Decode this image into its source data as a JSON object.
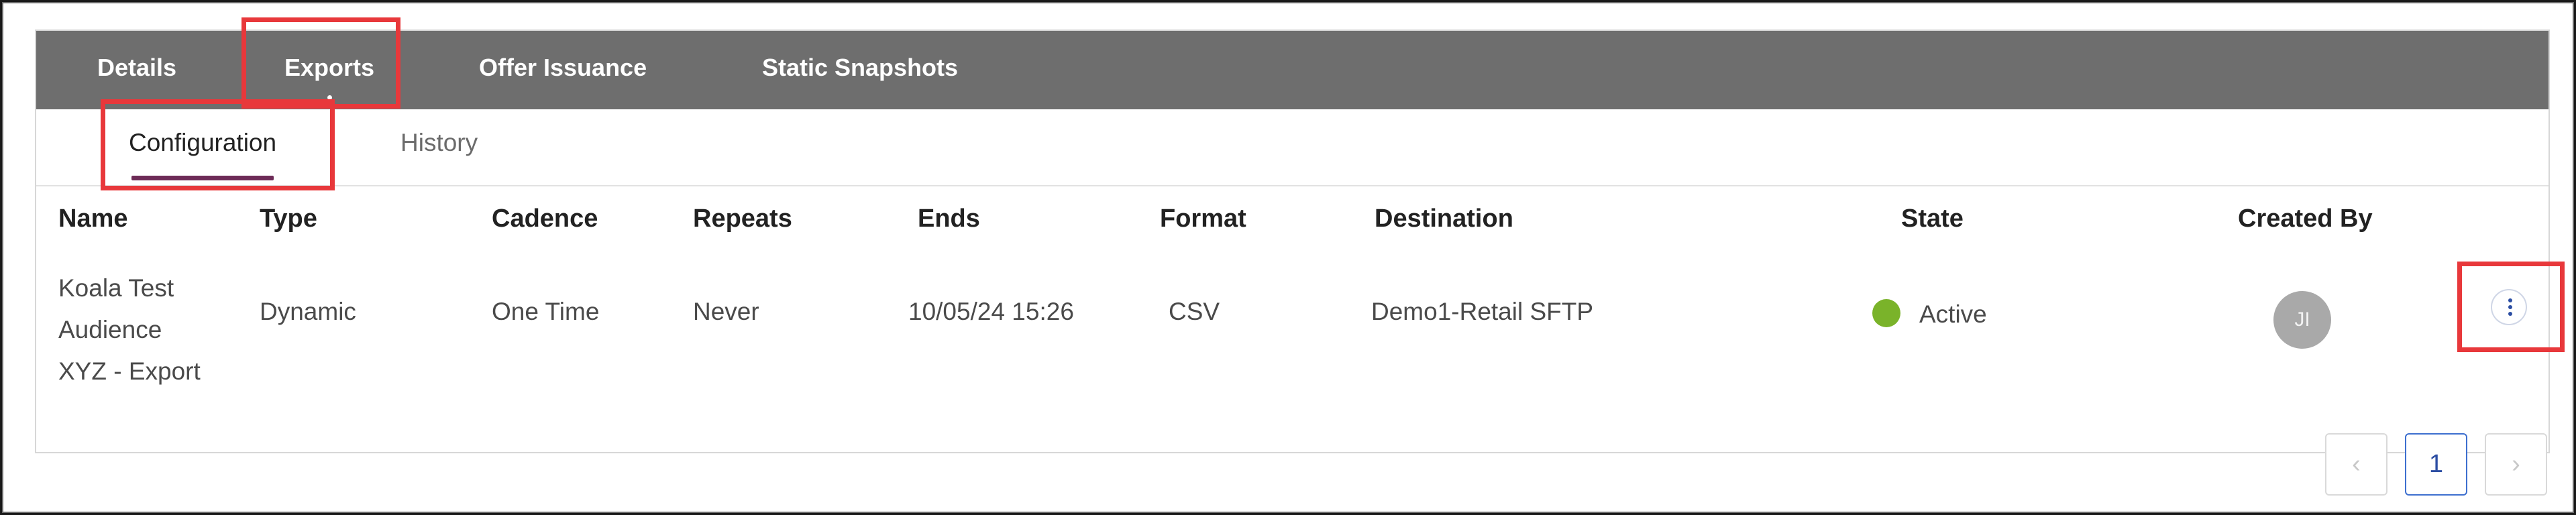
{
  "top_tabs": [
    {
      "label": "Details"
    },
    {
      "label": "Exports"
    },
    {
      "label": "Offer Issuance"
    },
    {
      "label": "Static Snapshots"
    }
  ],
  "sub_tabs": [
    {
      "label": "Configuration"
    },
    {
      "label": "History"
    }
  ],
  "table": {
    "columns": [
      "Name",
      "Type",
      "Cadence",
      "Repeats",
      "Ends",
      "Format",
      "Destination",
      "State",
      "Created By"
    ],
    "rows": [
      {
        "name_lines": [
          "Koala Test",
          "Audience",
          "XYZ - Export"
        ],
        "type": "Dynamic",
        "cadence": "One Time",
        "repeats": "Never",
        "ends": "10/05/24 15:26",
        "format": "CSV",
        "destination": "Demo1-Retail SFTP",
        "state": "Active",
        "created_by_initials": "JI"
      }
    ]
  },
  "pagination": {
    "prev": "‹",
    "current": "1",
    "next": "›"
  },
  "colors": {
    "nav_bar": "#6e6e6e",
    "active_underline": "#6d2b57",
    "highlight_box": "#e8383b",
    "status_active": "#7ab32a",
    "accent_blue": "#2c4ea3"
  },
  "icons": {
    "row_menu": "kebab-menu-icon",
    "prev_page": "chevron-left-icon",
    "next_page": "chevron-right-icon"
  }
}
